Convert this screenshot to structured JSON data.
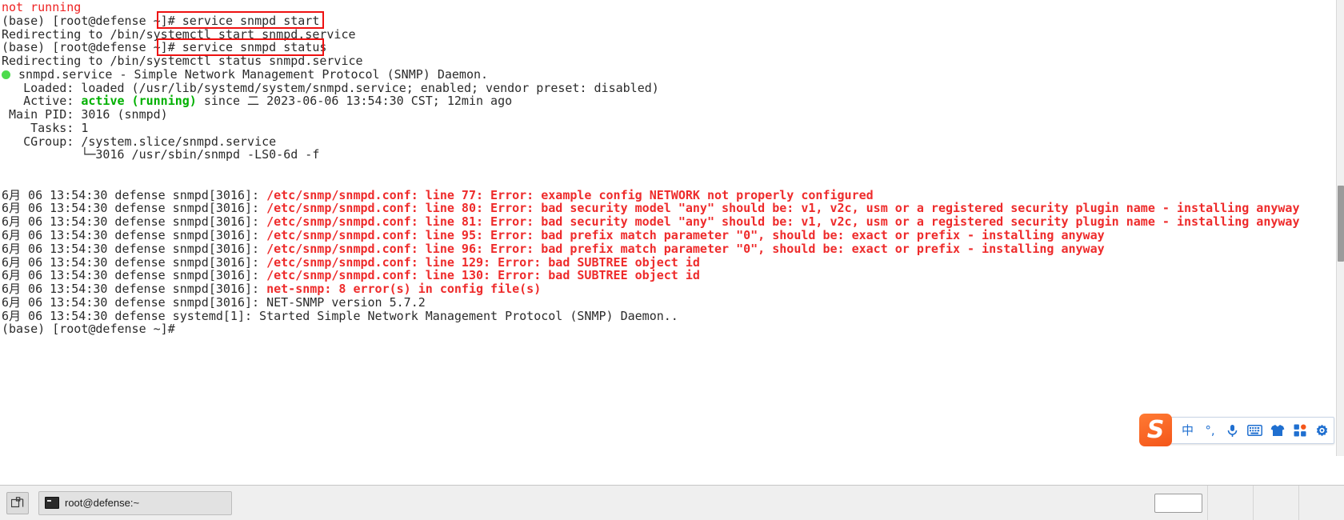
{
  "terminal": {
    "lines": [
      {
        "segments": [
          {
            "text": "not running",
            "style": "red"
          }
        ]
      },
      {
        "segments": [
          {
            "text": "(base) [root@defense ~]# service snmpd start",
            "style": "normal"
          }
        ]
      },
      {
        "segments": [
          {
            "text": "Redirecting to /bin/systemctl start snmpd.service",
            "style": "normal"
          }
        ]
      },
      {
        "segments": [
          {
            "text": "(base) [root@defense ~]# service snmpd status",
            "style": "normal"
          }
        ]
      },
      {
        "segments": [
          {
            "text": "Redirecting to /bin/systemctl status snmpd.service",
            "style": "normal"
          }
        ]
      },
      {
        "segments": [
          {
            "text": "",
            "style": "status-dot"
          },
          {
            "text": " snmpd.service - Simple Network Management Protocol (SNMP) Daemon.",
            "style": "normal"
          }
        ]
      },
      {
        "segments": [
          {
            "text": "   Loaded: loaded (/usr/lib/systemd/system/snmpd.service; enabled; vendor preset: disabled)",
            "style": "normal"
          }
        ]
      },
      {
        "segments": [
          {
            "text": "   Active: ",
            "style": "normal"
          },
          {
            "text": "active (running)",
            "style": "green"
          },
          {
            "text": " since 二 2023-06-06 13:54:30 CST; 12min ago",
            "style": "normal"
          }
        ]
      },
      {
        "segments": [
          {
            "text": " Main PID: 3016 (snmpd)",
            "style": "normal"
          }
        ]
      },
      {
        "segments": [
          {
            "text": "    Tasks: 1",
            "style": "normal"
          }
        ]
      },
      {
        "segments": [
          {
            "text": "   CGroup: /system.slice/snmpd.service",
            "style": "normal"
          }
        ]
      },
      {
        "segments": [
          {
            "text": "           └─3016 /usr/sbin/snmpd -LS0-6d -f",
            "style": "normal"
          }
        ]
      },
      {
        "segments": [
          {
            "text": "",
            "style": "normal"
          }
        ]
      },
      {
        "segments": [
          {
            "text": "",
            "style": "normal"
          }
        ]
      },
      {
        "segments": [
          {
            "text": "6月 06 13:54:30 defense snmpd[3016]: ",
            "style": "normal"
          },
          {
            "text": "/etc/snmp/snmpd.conf: line 77: Error: example config NETWORK not properly configured",
            "style": "red-bold"
          }
        ]
      },
      {
        "segments": [
          {
            "text": "6月 06 13:54:30 defense snmpd[3016]: ",
            "style": "normal"
          },
          {
            "text": "/etc/snmp/snmpd.conf: line 80: Error: bad security model \"any\" should be: v1, v2c, usm or a registered security plugin name - installing anyway",
            "style": "red-bold"
          }
        ]
      },
      {
        "segments": [
          {
            "text": "6月 06 13:54:30 defense snmpd[3016]: ",
            "style": "normal"
          },
          {
            "text": "/etc/snmp/snmpd.conf: line 81: Error: bad security model \"any\" should be: v1, v2c, usm or a registered security plugin name - installing anyway",
            "style": "red-bold"
          }
        ]
      },
      {
        "segments": [
          {
            "text": "6月 06 13:54:30 defense snmpd[3016]: ",
            "style": "normal"
          },
          {
            "text": "/etc/snmp/snmpd.conf: line 95: Error: bad prefix match parameter \"0\", should be: exact or prefix - installing anyway",
            "style": "red-bold"
          }
        ]
      },
      {
        "segments": [
          {
            "text": "6月 06 13:54:30 defense snmpd[3016]: ",
            "style": "normal"
          },
          {
            "text": "/etc/snmp/snmpd.conf: line 96: Error: bad prefix match parameter \"0\", should be: exact or prefix - installing anyway",
            "style": "red-bold"
          }
        ]
      },
      {
        "segments": [
          {
            "text": "6月 06 13:54:30 defense snmpd[3016]: ",
            "style": "normal"
          },
          {
            "text": "/etc/snmp/snmpd.conf: line 129: Error: bad SUBTREE object id",
            "style": "red-bold"
          }
        ]
      },
      {
        "segments": [
          {
            "text": "6月 06 13:54:30 defense snmpd[3016]: ",
            "style": "normal"
          },
          {
            "text": "/etc/snmp/snmpd.conf: line 130: Error: bad SUBTREE object id",
            "style": "red-bold"
          }
        ]
      },
      {
        "segments": [
          {
            "text": "6月 06 13:54:30 defense snmpd[3016]: ",
            "style": "normal"
          },
          {
            "text": "net-snmp: 8 error(s) in config file(s)",
            "style": "red-bold"
          }
        ]
      },
      {
        "segments": [
          {
            "text": "6月 06 13:54:30 defense snmpd[3016]: NET-SNMP version 5.7.2",
            "style": "normal"
          }
        ]
      },
      {
        "segments": [
          {
            "text": "6月 06 13:54:30 defense systemd[1]: Started Simple Network Management Protocol (SNMP) Daemon..",
            "style": "normal"
          }
        ]
      },
      {
        "segments": [
          {
            "text": "(base) [root@defense ~]# ",
            "style": "normal"
          }
        ]
      }
    ],
    "highlight_boxes": [
      {
        "label": "service snmpd start"
      },
      {
        "label": "service snmpd status"
      }
    ]
  },
  "ime": {
    "logo_label": "S",
    "items": [
      {
        "name": "chinese-mode-icon",
        "label": "中"
      },
      {
        "name": "punctuation-mode-icon",
        "label": "°,"
      },
      {
        "name": "microphone-icon",
        "label": ""
      },
      {
        "name": "keyboard-icon",
        "label": ""
      },
      {
        "name": "skin-icon",
        "label": ""
      },
      {
        "name": "toolbox-icon",
        "label": ""
      },
      {
        "name": "settings-icon",
        "label": ""
      }
    ]
  },
  "taskbar": {
    "window_button_label": "root@defense:~"
  },
  "colors": {
    "error_red": "#ee2b2b",
    "active_green": "#00b000",
    "highlight_border": "#ee1111",
    "ime_accent": "#f4561a",
    "ime_blue": "#1f6fd0"
  }
}
